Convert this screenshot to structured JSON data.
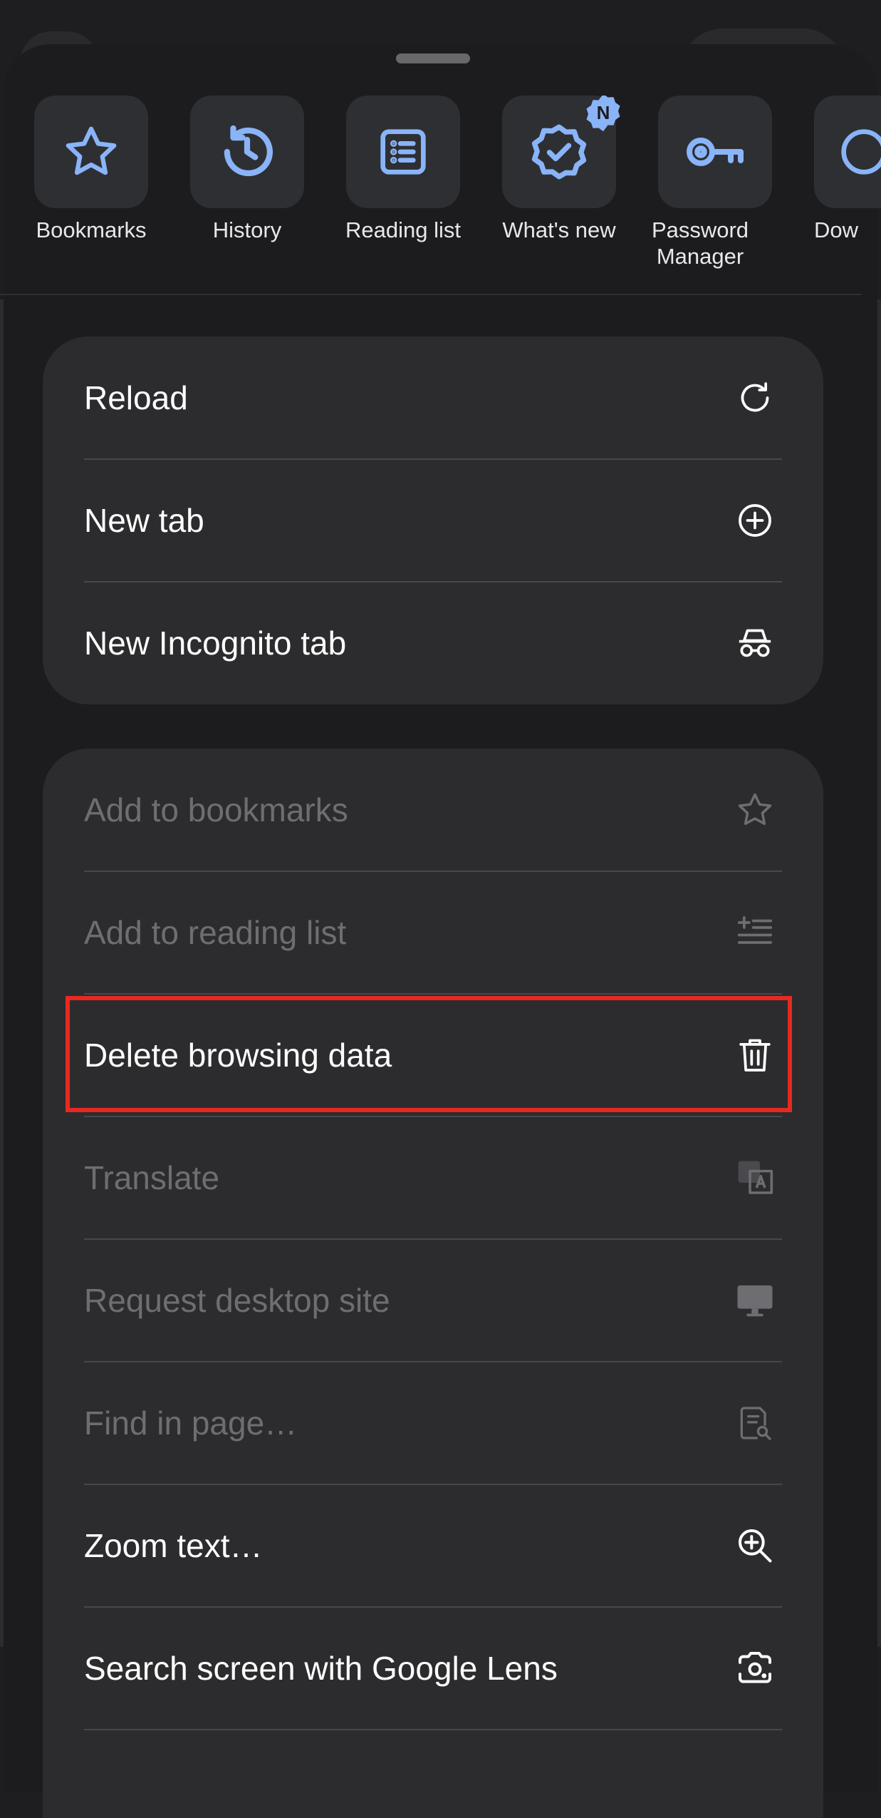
{
  "colors": {
    "accent": "#8ab4f8",
    "highlight": "#e8291f",
    "disabled_text": "#6e6e72"
  },
  "shortcuts": [
    {
      "label": "Bookmarks",
      "icon": "star-icon"
    },
    {
      "label": "History",
      "icon": "history-icon"
    },
    {
      "label": "Reading list",
      "icon": "reading-list-icon"
    },
    {
      "label": "What's new",
      "icon": "whats-new-icon",
      "badge": "N"
    },
    {
      "label": "Password Manager",
      "icon": "key-icon"
    },
    {
      "label": "Dow",
      "icon": "download-icon"
    }
  ],
  "menu_group_1": [
    {
      "label": "Reload",
      "icon": "reload-icon",
      "enabled": true
    },
    {
      "label": "New tab",
      "icon": "plus-circle-icon",
      "enabled": true
    },
    {
      "label": "New Incognito tab",
      "icon": "incognito-icon",
      "enabled": true
    }
  ],
  "menu_group_2": [
    {
      "label": "Add to bookmarks",
      "icon": "star-icon",
      "enabled": false
    },
    {
      "label": "Add to reading list",
      "icon": "add-reading-list-icon",
      "enabled": false
    },
    {
      "label": "Delete browsing data",
      "icon": "trash-icon",
      "enabled": true,
      "highlighted": true
    },
    {
      "label": "Translate",
      "icon": "translate-icon",
      "enabled": false
    },
    {
      "label": "Request desktop site",
      "icon": "desktop-icon",
      "enabled": false
    },
    {
      "label": "Find in page…",
      "icon": "find-in-page-icon",
      "enabled": false
    },
    {
      "label": "Zoom text…",
      "icon": "zoom-in-icon",
      "enabled": true
    },
    {
      "label": "Search screen with Google Lens",
      "icon": "lens-icon",
      "enabled": true
    }
  ]
}
